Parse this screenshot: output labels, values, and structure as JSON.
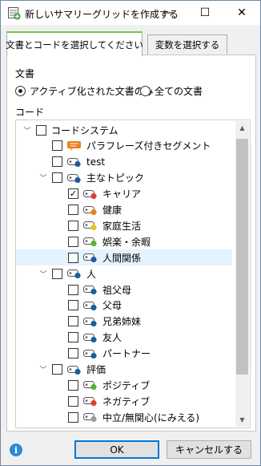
{
  "window": {
    "title": "新しいサマリーグリッドを作成する",
    "minimize_glyph": "—",
    "maximize_glyph": "☐",
    "close_glyph": "✕"
  },
  "tabs": [
    {
      "label": "文書とコードを選択してください",
      "active": true
    },
    {
      "label": "変数を選択する",
      "active": false
    }
  ],
  "documents": {
    "label": "文書",
    "options": [
      {
        "label": "アクティブ化された文書のみ",
        "selected": true
      },
      {
        "label": "全ての文書",
        "selected": false
      }
    ]
  },
  "codes": {
    "label": "コード",
    "tree": [
      {
        "label": "コードシステム",
        "level": 0,
        "expander": "﹀",
        "checked": false,
        "icon": "none"
      },
      {
        "label": "パラフレーズ付きセグメント",
        "level": 1,
        "expander": "",
        "checked": false,
        "icon": "speech-bubble",
        "color": "#e8821e"
      },
      {
        "label": "test",
        "level": 1,
        "expander": "",
        "checked": false,
        "icon": "code-tag",
        "color": "#1f5aa6"
      },
      {
        "label": "主なトピック",
        "level": 1,
        "expander": "﹀",
        "checked": false,
        "icon": "code-tag",
        "color": "#1f5aa6"
      },
      {
        "label": "キャリア",
        "level": 2,
        "expander": "",
        "checked": true,
        "icon": "code-tag",
        "color": "#e03c31"
      },
      {
        "label": "健康",
        "level": 2,
        "expander": "",
        "checked": false,
        "icon": "code-tag",
        "color": "#e8821e"
      },
      {
        "label": "家庭生活",
        "level": 2,
        "expander": "",
        "checked": false,
        "icon": "code-tag",
        "color": "#e6c619"
      },
      {
        "label": "娯楽・余暇",
        "level": 2,
        "expander": "",
        "checked": false,
        "icon": "code-tag",
        "color": "#5cb030"
      },
      {
        "label": "人間関係",
        "level": 2,
        "expander": "",
        "checked": false,
        "icon": "code-tag",
        "color": "#1f5aa6",
        "selected": true
      },
      {
        "label": "人",
        "level": 1,
        "expander": "﹀",
        "checked": false,
        "icon": "code-tag",
        "color": "#1f5aa6"
      },
      {
        "label": "祖父母",
        "level": 2,
        "expander": "",
        "checked": false,
        "icon": "code-tag",
        "color": "#1f5aa6"
      },
      {
        "label": "父母",
        "level": 2,
        "expander": "",
        "checked": false,
        "icon": "code-tag",
        "color": "#1f5aa6"
      },
      {
        "label": "兄弟姉妹",
        "level": 2,
        "expander": "",
        "checked": false,
        "icon": "code-tag",
        "color": "#1f5aa6"
      },
      {
        "label": "友人",
        "level": 2,
        "expander": "",
        "checked": false,
        "icon": "code-tag",
        "color": "#1f5aa6"
      },
      {
        "label": "パートナー",
        "level": 2,
        "expander": "",
        "checked": false,
        "icon": "code-tag",
        "color": "#1f5aa6"
      },
      {
        "label": "評価",
        "level": 1,
        "expander": "﹀",
        "checked": false,
        "icon": "code-tag",
        "color": "#1f5aa6"
      },
      {
        "label": "ポジティブ",
        "level": 2,
        "expander": "",
        "checked": false,
        "icon": "code-tag",
        "color": "#5cb030"
      },
      {
        "label": "ネガティブ",
        "level": 2,
        "expander": "",
        "checked": false,
        "icon": "code-tag",
        "color": "#e03c31"
      },
      {
        "label": "中立/無関心(にみえる)",
        "level": 2,
        "expander": "",
        "checked": false,
        "icon": "code-tag",
        "color": "#9a9a9a"
      }
    ]
  },
  "buttons": {
    "ok": "OK",
    "cancel": "キャンセルする",
    "info": "i"
  },
  "scrollbar": {
    "up_glyph": "▲",
    "down_glyph": "▼"
  }
}
